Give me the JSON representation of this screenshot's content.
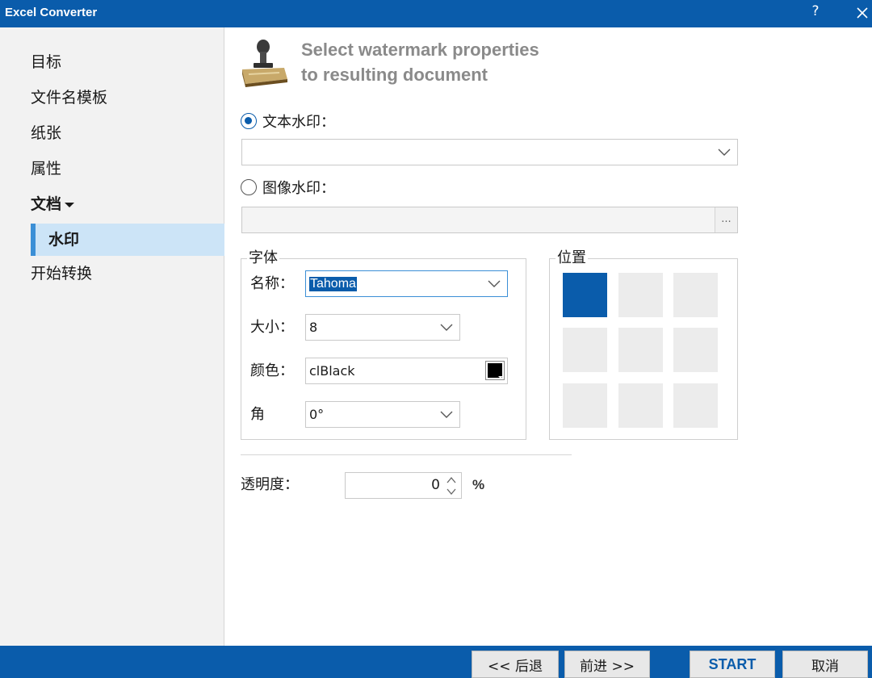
{
  "window": {
    "title": "Excel Converter",
    "help_label": "?"
  },
  "sidebar": {
    "items": [
      {
        "label": "目标"
      },
      {
        "label": "文件名模板"
      },
      {
        "label": "纸张"
      },
      {
        "label": "属性"
      },
      {
        "label": "文档"
      },
      {
        "label": "水印"
      },
      {
        "label": "开始转换"
      }
    ],
    "selected": "水印"
  },
  "header": {
    "line1": "Select watermark properties",
    "line2": "to resulting document"
  },
  "watermark": {
    "text_option_label": "文本水印：",
    "text_selected": true,
    "text_value": "",
    "image_option_label": "图像水印：",
    "image_value": "",
    "browse_label": "..."
  },
  "font_group": {
    "title": "字体",
    "name_label": "名称：",
    "name_value": "Tahoma",
    "size_label": "大小：",
    "size_value": "8",
    "color_label": "颜色：",
    "color_value": "clBlack",
    "color_hex": "#000000",
    "angle_label": "角",
    "angle_value": "0°"
  },
  "position_group": {
    "title": "位置",
    "selected_index": 0,
    "grid": "3x3"
  },
  "transparency": {
    "label": "透明度：",
    "value": "0",
    "unit": "%"
  },
  "footer": {
    "back_label": "<< 后退",
    "next_label": "前进 >>",
    "start_label": "START",
    "cancel_label": "取消"
  },
  "colors": {
    "accent": "#0a5cab",
    "selection": "#cce4f7",
    "selection_bar": "#3b8fd6",
    "title_gray": "#8a8a8a"
  }
}
